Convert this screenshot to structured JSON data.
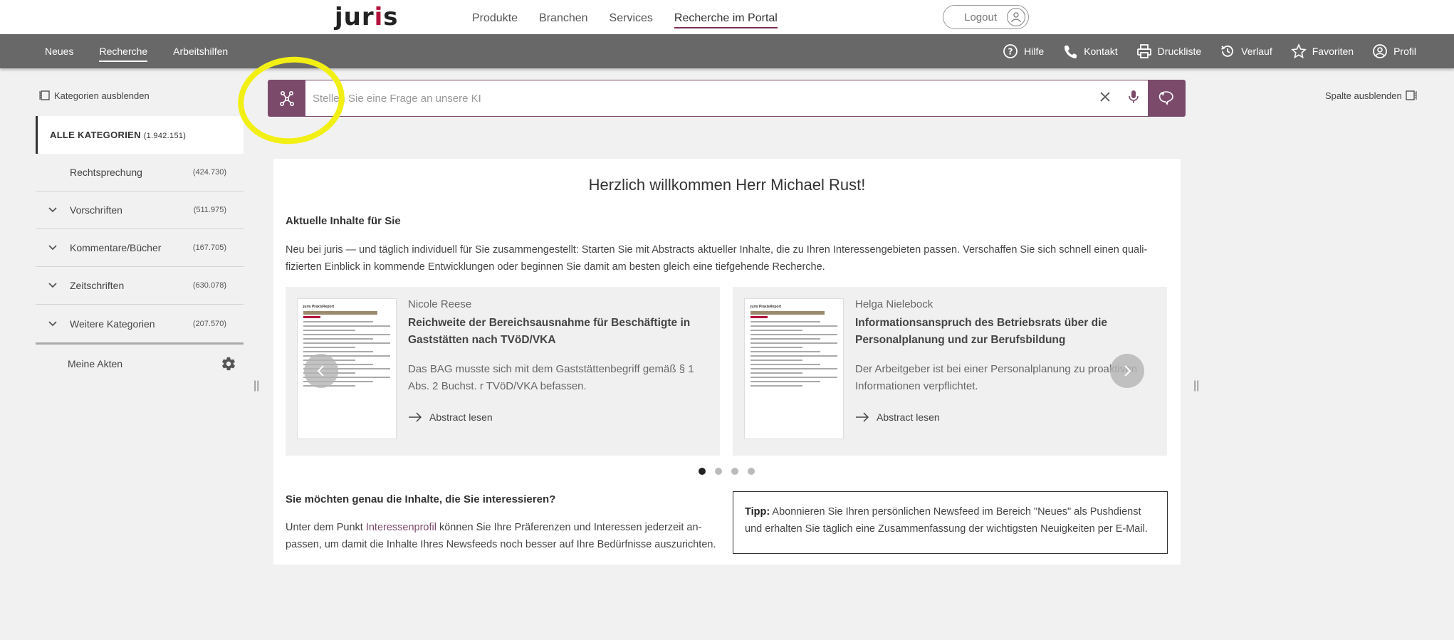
{
  "topbar": {
    "logo": "juris",
    "nav": [
      "Produkte",
      "Branchen",
      "Services",
      "Recherche im Portal"
    ],
    "logout": "Logout"
  },
  "subbar": {
    "nav": [
      "Neues",
      "Recherche",
      "Arbeitshilfen"
    ],
    "utils": {
      "help": "Hilfe",
      "contact": "Kontakt",
      "printlist": "Druckliste",
      "history": "Verlauf",
      "favorites": "Favoriten",
      "profile": "Profil"
    }
  },
  "sidebar": {
    "hide_label": "Kategorien ausblenden",
    "all": {
      "label": "ALLE KATEGORIEN",
      "count": "(1.942.151)"
    },
    "items": [
      {
        "label": "Rechtsprechung",
        "count": "(424.730)"
      },
      {
        "label": "Vorschriften",
        "count": "(511.975)"
      },
      {
        "label": "Kommentare/Bücher",
        "count": "(167.705)"
      },
      {
        "label": "Zeitschriften",
        "count": "(630.078)"
      },
      {
        "label": "Weitere Kategorien",
        "count": "(207.570)"
      }
    ],
    "akten": "Meine Akten"
  },
  "search": {
    "placeholder": "Stellen Sie eine Frage an unsere KI",
    "value": ""
  },
  "hide_column": "Spalte ausblenden",
  "main": {
    "welcome": "Herzlich willkommen Herr Michael Rust!",
    "current_heading": "Aktuelle Inhalte für Sie",
    "current_text": "Neu bei juris — und täglich individuell für Sie zusammengestellt: Starten Sie mit Abstracts aktueller Inhalte, die zu Ihren Interessengebieten passen. Verschaffen Sie sich schnell einen quali­fizierten Einblick in kommende Entwicklungen oder beginnen Sie damit am besten gleich eine tiefgehende Recherche.",
    "cards": [
      {
        "author": "Nicole Reese",
        "title": "Reichweite der Bereichsausnahme für Beschäftigte in Gaststätten nach TVöD/VKA",
        "desc": "Das BAG musste sich mit dem Gaststättenbegriff gemäß § 1 Abs. 2 Buchst. r TVöD/VKA befassen.",
        "link": "Abstract lesen",
        "thumb_brand": "juris PraxisReport"
      },
      {
        "author": "Helga Nielebock",
        "title": "Informationsanspruch des Betriebsrats über die Personalplanung und zur Berufsbildung",
        "desc": "Der Arbeitgeber ist bei einer Personalplanung zu proaktiven Informationen verpflichtet.",
        "link": "Abstract lesen",
        "thumb_brand": "juris PraxisReport"
      }
    ],
    "interests_heading": "Sie möchten genau die Inhalte, die Sie interessieren?",
    "interests_pre": "Unter dem Punkt ",
    "interests_link": "Interessenprofil",
    "interests_post": " können Sie Ihre Präferenzen und Interessen jederzeit an­passen, um damit die Inhalte Ihres Newsfeeds noch besser auf Ihre Bedürfnisse auszurichten.",
    "tip_label": "Tipp:",
    "tip_text": " Abonnieren Sie Ihren persönlichen Newsfeed im Bereich \"Neues\" als Pushdienst und erhalten Sie täglich eine Zusammenfassung der wichtigsten Neuigkeiten per E-Mail."
  }
}
